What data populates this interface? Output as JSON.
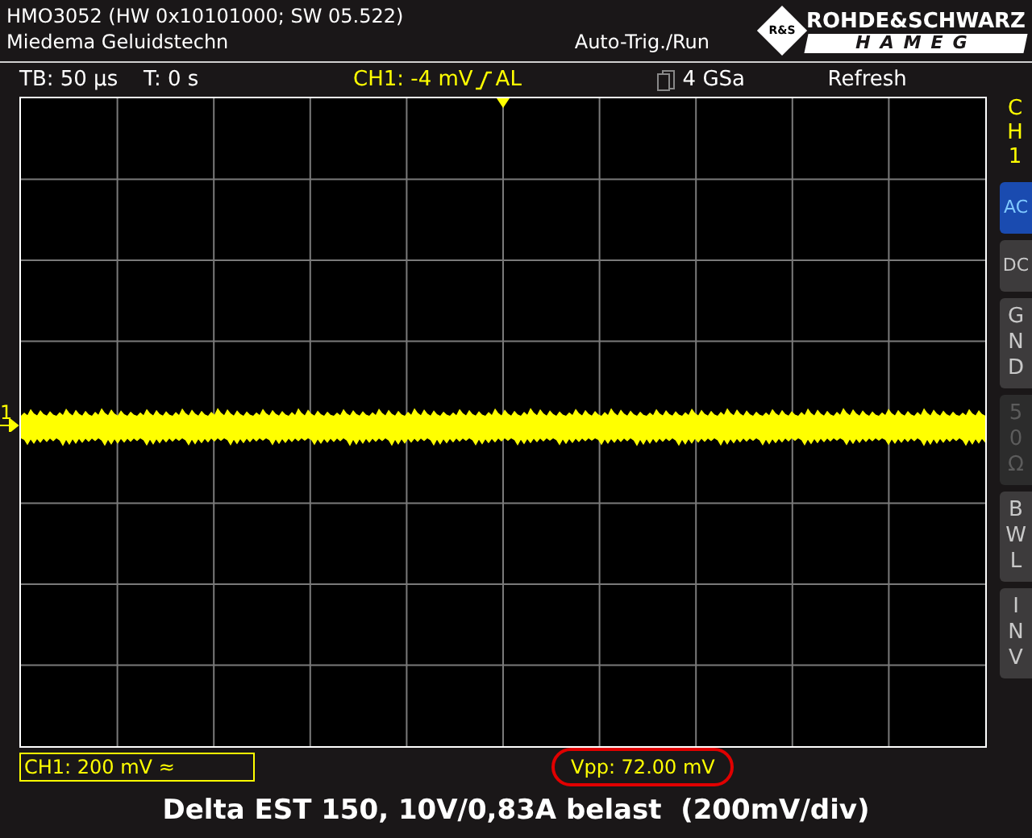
{
  "header": {
    "model": "HMO3052 (HW 0x10101000; SW 05.522)",
    "user": "Miedema Geluidstechn",
    "mode": "Auto-Trig./Run"
  },
  "logo": {
    "brand": "ROHDE&SCHWARZ",
    "subbrand": "HAMEG",
    "emblem": "R&S"
  },
  "status_bar": {
    "timebase": "TB: 50 µs",
    "trigger_time": "T: 0 s",
    "trigger_level": "CH1: -4 mV",
    "trigger_source": "AL",
    "sample_rate": "4 GSa",
    "mode": "Refresh"
  },
  "channel_marker": "1",
  "sidebar": {
    "channel": "CH1",
    "buttons": [
      {
        "label": "AC",
        "kind": "row",
        "selected": true,
        "disabled": false
      },
      {
        "label": "DC",
        "kind": "row",
        "selected": false,
        "disabled": false
      },
      {
        "label": "GND",
        "kind": "stacked",
        "selected": false,
        "disabled": false
      },
      {
        "label": "50Ω",
        "kind": "stacked",
        "selected": false,
        "disabled": true
      },
      {
        "label": "BWL",
        "kind": "stacked",
        "selected": false,
        "disabled": false
      },
      {
        "label": "INV",
        "kind": "stacked",
        "selected": false,
        "disabled": false
      }
    ]
  },
  "channel_scale": {
    "label": "CH1: 200 mV",
    "coupling_symbol": "≈"
  },
  "measurement": {
    "label": "Vpp: 72.00 mV",
    "circled": true
  },
  "caption": "Delta EST 150, 10V/0,83A belast  (200mV/div)"
}
